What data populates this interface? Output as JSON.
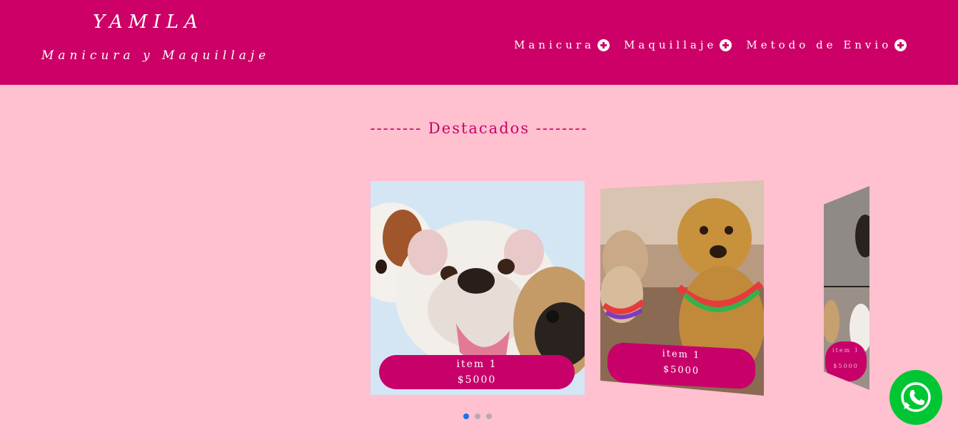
{
  "brand": {
    "title": "YAMILA",
    "subtitle": "Manicura y Maquillaje"
  },
  "nav": {
    "items": [
      {
        "label": "Manicura",
        "icon": "plus-circle-icon"
      },
      {
        "label": "Maquillaje",
        "icon": "plus-circle-icon"
      },
      {
        "label": "Metodo de Envio",
        "icon": "plus-circle-icon"
      }
    ]
  },
  "featured": {
    "title": "-------- Destacados --------",
    "cards": [
      {
        "name": "item 1",
        "price": "$5000"
      },
      {
        "name": "item 1",
        "price": "$5000"
      },
      {
        "name": "item 1",
        "price": "$5000"
      }
    ],
    "dots": 3,
    "active_dot": 0
  },
  "colors": {
    "header": "#cc0066",
    "background": "#ffc0cf",
    "accent": "#c8006a",
    "whatsapp": "#00c634"
  },
  "floating": {
    "icon": "whatsapp-icon"
  }
}
